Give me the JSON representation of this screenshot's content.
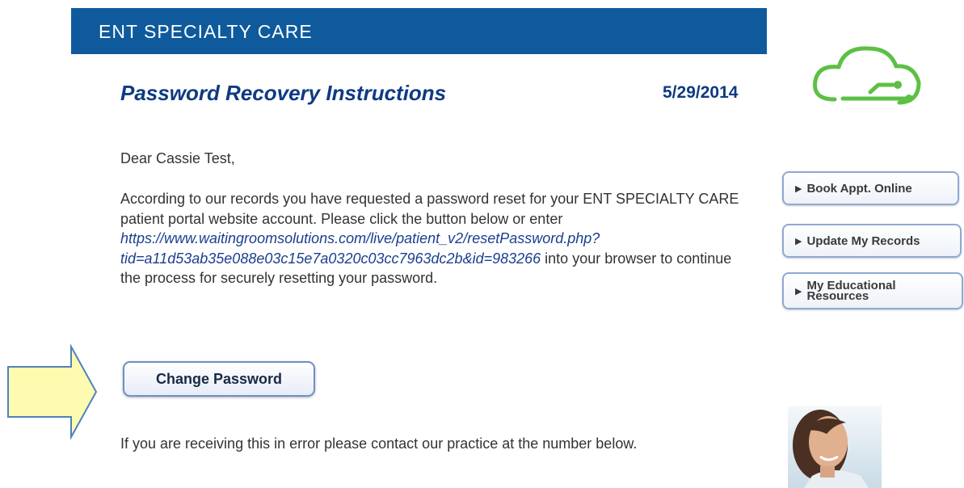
{
  "header": {
    "title": "ENT SPECIALTY CARE"
  },
  "email": {
    "heading": "Password Recovery Instructions",
    "date": "5/29/2014",
    "greeting": "Dear Cassie Test,",
    "paragraph_before_link": "According to our records you have requested a password reset for your ENT SPECIALTY CARE patient portal website account. Please click the button below or enter",
    "link_line1": "https://www.waitingroomsolutions.com/live/patient_v2/resetPassword.php?",
    "link_line2": "tid=a11d53ab35e088e03c15e7a0320c03cc7963dc2b&id=983266",
    "paragraph_after_link": "into your browser to continue the process for securely resetting your password.",
    "change_password_label": "Change Password",
    "error_text": "If you are receiving this in error please contact our practice at the number below."
  },
  "sidebar": {
    "book_label": "Book Appt. Online",
    "update_label": "Update My Records",
    "edu_label_line1": "My Educational",
    "edu_label_line2": "Resources"
  },
  "icons": {
    "logo": "cloud-logo-icon",
    "arrow": "right-arrow-icon",
    "button_marker": "play-triangle-icon"
  },
  "colors": {
    "header_bg": "#0e5a9c",
    "heading": "#0e3a82",
    "link": "#1b3e8f",
    "arrow_fill": "#fdfbb0",
    "arrow_stroke": "#4f81bd",
    "cloud": "#5cc044"
  }
}
